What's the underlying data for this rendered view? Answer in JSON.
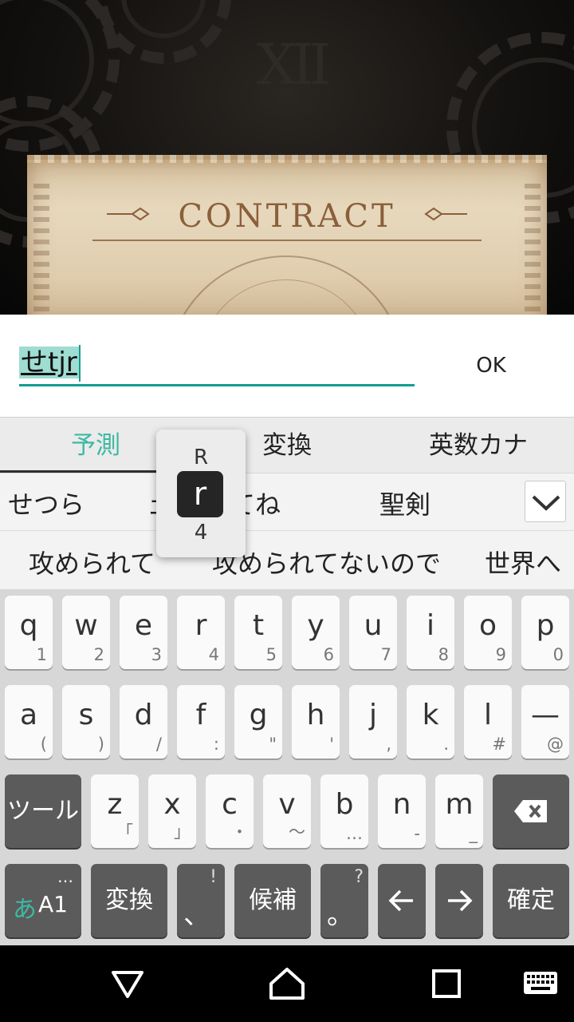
{
  "game": {
    "contract_title": "CONTRACT"
  },
  "dialog": {
    "input_value": "せtjr",
    "ok_label": "OK"
  },
  "ime": {
    "tabs": [
      "予測",
      "変換",
      "英数カナ"
    ],
    "candidates_row1": [
      "せつら",
      "ェ",
      "てね",
      "聖剣"
    ],
    "candidates_row2": [
      "攻められて",
      "攻められてないので",
      "世界へ"
    ],
    "popup": {
      "upper": "R",
      "main": "r",
      "lower": "4"
    },
    "row1": [
      {
        "main": "q",
        "sub": "1"
      },
      {
        "main": "w",
        "sub": "2"
      },
      {
        "main": "e",
        "sub": "3"
      },
      {
        "main": "r",
        "sub": "4"
      },
      {
        "main": "t",
        "sub": "5"
      },
      {
        "main": "y",
        "sub": "6"
      },
      {
        "main": "u",
        "sub": "7"
      },
      {
        "main": "i",
        "sub": "8"
      },
      {
        "main": "o",
        "sub": "9"
      },
      {
        "main": "p",
        "sub": "0"
      }
    ],
    "row2": [
      {
        "main": "a",
        "sub": "("
      },
      {
        "main": "s",
        "sub": ")"
      },
      {
        "main": "d",
        "sub": "/"
      },
      {
        "main": "f",
        "sub": ":"
      },
      {
        "main": "g",
        "sub": "\""
      },
      {
        "main": "h",
        "sub": "'"
      },
      {
        "main": "j",
        "sub": ","
      },
      {
        "main": "k",
        "sub": "."
      },
      {
        "main": "l",
        "sub": "#"
      },
      {
        "main": "—",
        "sub": "@"
      }
    ],
    "row3": [
      {
        "main": "z",
        "sub": "「"
      },
      {
        "main": "x",
        "sub": "」"
      },
      {
        "main": "c",
        "sub": "・"
      },
      {
        "main": "v",
        "sub": "〜"
      },
      {
        "main": "b",
        "sub": "…"
      },
      {
        "main": "n",
        "sub": "-"
      },
      {
        "main": "m",
        "sub": "_"
      }
    ],
    "tool_label": "ツール",
    "mode_label_kana": "あ",
    "mode_label_alnum": "A1",
    "mode_dots": "…",
    "convert_label": "変換",
    "comma_main": "、",
    "comma_sub": "!",
    "candidate_label": "候補",
    "period_main": "。",
    "period_sub": "?",
    "confirm_label": "確定"
  },
  "colors": {
    "accent": "#3cb9a4",
    "underline": "#149d91",
    "dark_key": "#5b5b5b"
  },
  "icons": [
    "backspace-icon",
    "arrow-left-icon",
    "arrow-right-icon",
    "chevron-down-icon",
    "nav-back-icon",
    "nav-home-icon",
    "nav-recents-icon",
    "keyboard-icon"
  ]
}
